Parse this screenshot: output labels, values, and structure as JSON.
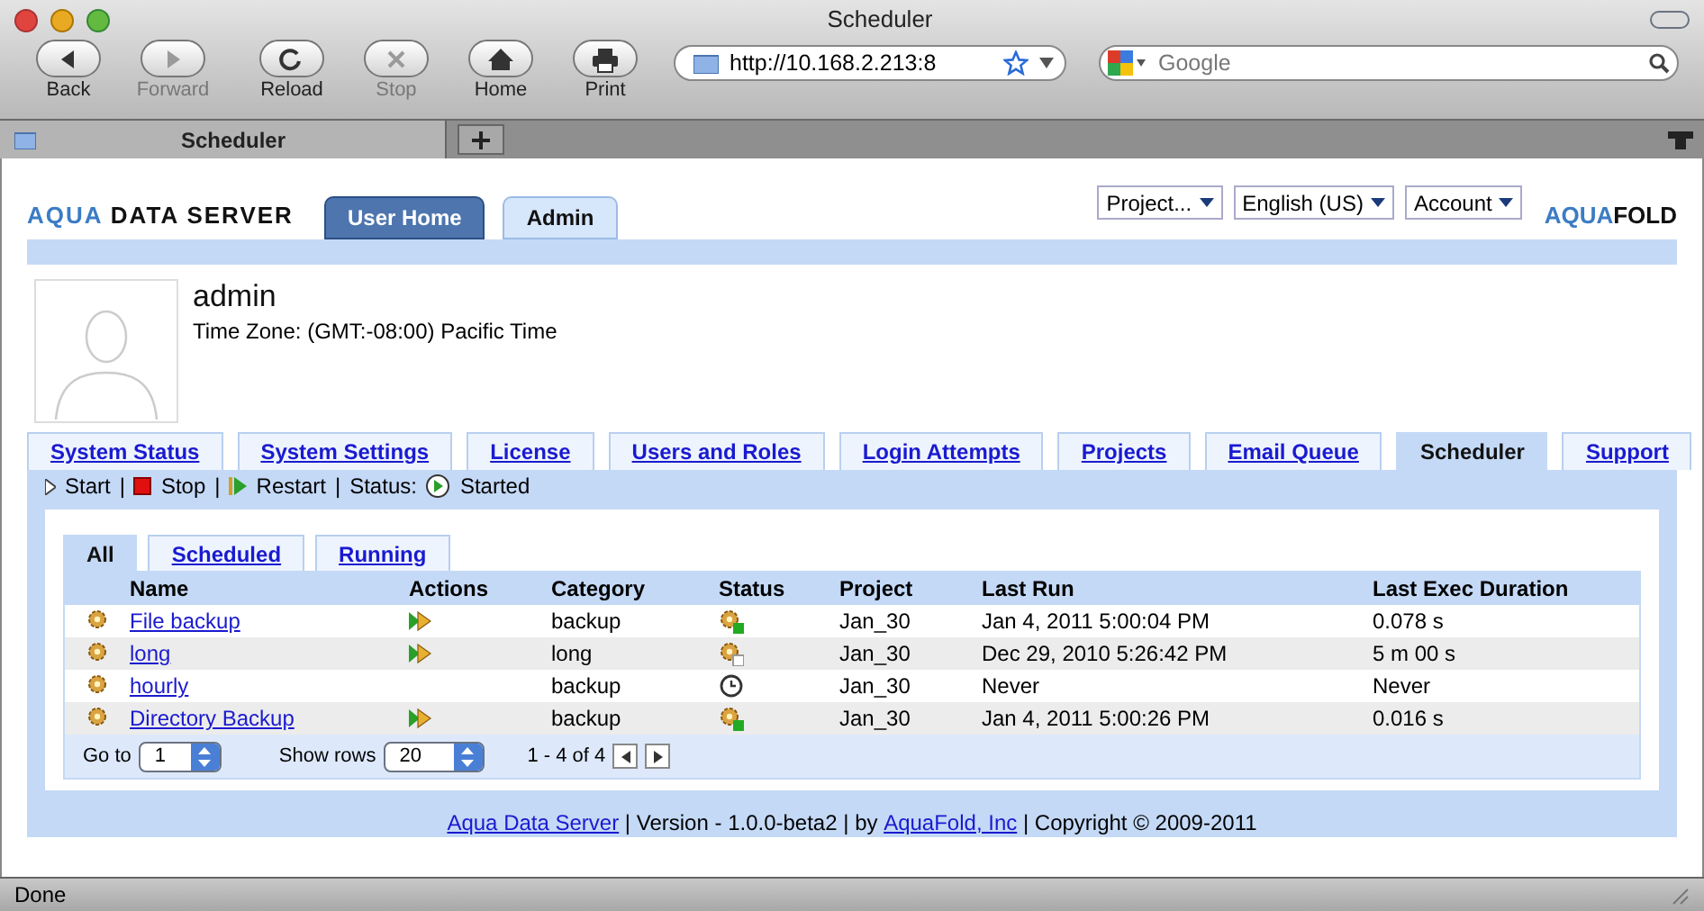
{
  "window": {
    "title": "Scheduler"
  },
  "toolbar": {
    "buttons": [
      {
        "label": "Back",
        "kind": "back",
        "disabled": false
      },
      {
        "label": "Forward",
        "kind": "forward",
        "disabled": true
      },
      {
        "label": "Reload",
        "kind": "reload",
        "disabled": false
      },
      {
        "label": "Stop",
        "kind": "stop",
        "disabled": true
      },
      {
        "label": "Home",
        "kind": "home",
        "disabled": false
      },
      {
        "label": "Print",
        "kind": "print",
        "disabled": false
      }
    ],
    "address": "http://10.168.2.213:8",
    "search": {
      "placeholder": "Google"
    }
  },
  "browser_tabs": [
    {
      "label": "Scheduler",
      "selected": true
    }
  ],
  "header": {
    "logo_left": [
      "AQUA",
      " DATA SERVER"
    ],
    "tabs": [
      {
        "label": "User Home",
        "selected": false
      },
      {
        "label": "Admin",
        "selected": true
      }
    ],
    "menus": [
      "Project...",
      "English (US)",
      "Account"
    ],
    "logo_right": [
      "AQUA",
      "FOLD"
    ]
  },
  "user": {
    "name": "admin",
    "timezone": "Time Zone: (GMT:-08:00) Pacific Time"
  },
  "admin_tabs": [
    {
      "label": "System Status",
      "selected": false
    },
    {
      "label": "System Settings",
      "selected": false
    },
    {
      "label": "License",
      "selected": false
    },
    {
      "label": "Users and Roles",
      "selected": false
    },
    {
      "label": "Login Attempts",
      "selected": false
    },
    {
      "label": "Projects",
      "selected": false
    },
    {
      "label": "Email Queue",
      "selected": false
    },
    {
      "label": "Scheduler",
      "selected": true
    },
    {
      "label": "Support",
      "selected": false
    }
  ],
  "controls": {
    "start": "Start",
    "sep1": "|",
    "stop": "Stop",
    "sep2": "|",
    "restart": "Restart",
    "sep3": "|",
    "status_label": "Status:",
    "status": "Started"
  },
  "sub_tabs": [
    {
      "label": "All",
      "selected": true
    },
    {
      "label": "Scheduled",
      "selected": false
    },
    {
      "label": "Running",
      "selected": false
    }
  ],
  "table": {
    "columns": [
      "Name",
      "Actions",
      "Category",
      "Status",
      "Project",
      "Last Run",
      "Last Exec Duration"
    ],
    "rows": [
      {
        "name": "File backup",
        "run_action": true,
        "category": "backup",
        "kind": "ok",
        "project": "Jan_30",
        "last_run": "Jan 4, 2011 5:00:04 PM",
        "duration": "0.078 s"
      },
      {
        "name": "long",
        "run_action": true,
        "category": "long",
        "kind": "idle",
        "project": "Jan_30",
        "last_run": "Dec 29, 2010 5:26:42 PM",
        "duration": "5 m 00 s"
      },
      {
        "name": "hourly",
        "run_action": false,
        "category": "backup",
        "kind": "timer",
        "project": "Jan_30",
        "last_run": "Never",
        "duration": "Never"
      },
      {
        "name": "Directory Backup",
        "run_action": true,
        "category": "backup",
        "kind": "ok",
        "project": "Jan_30",
        "last_run": "Jan 4, 2011 5:00:26 PM",
        "duration": "0.016 s"
      }
    ]
  },
  "pager": {
    "goto_label": "Go to",
    "page": "1",
    "rows_label": "Show rows",
    "rows": "20",
    "range": "1 - 4 of 4"
  },
  "footer": [
    {
      "kind": "link",
      "text": "Aqua Data Server"
    },
    {
      "kind": "text",
      "text": " | Version - 1.0.0-beta2 | by "
    },
    {
      "kind": "link",
      "text": "AquaFold, Inc"
    },
    {
      "kind": "text",
      "text": " | Copyright © 2009-2011"
    }
  ],
  "status_bar": "Done"
}
